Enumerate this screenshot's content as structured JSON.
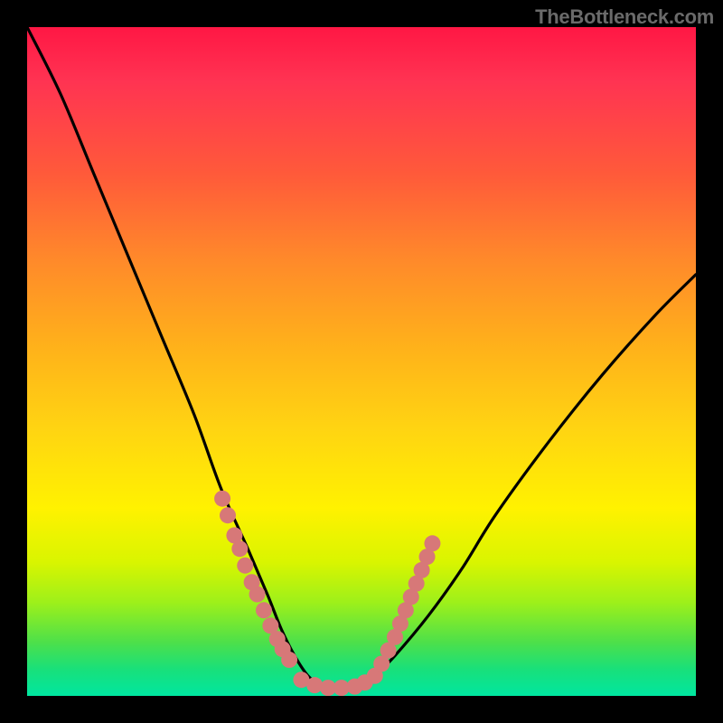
{
  "credit": "TheBottleneck.com",
  "chart_data": {
    "type": "line",
    "title": "",
    "xlabel": "",
    "ylabel": "",
    "xlim": [
      0,
      100
    ],
    "ylim": [
      0,
      100
    ],
    "grid": false,
    "legend": false,
    "series": [
      {
        "name": "bottleneck-curve",
        "x": [
          0,
          5,
          10,
          15,
          20,
          25,
          29,
          33,
          36,
          38,
          40,
          42,
          44,
          46,
          48,
          50,
          52,
          55,
          60,
          65,
          70,
          78,
          86,
          94,
          100
        ],
        "y": [
          100,
          90,
          78,
          66,
          54,
          42,
          31,
          22,
          15,
          10,
          6,
          3,
          1.5,
          1,
          1,
          1.5,
          3,
          6,
          12,
          19,
          27,
          38,
          48,
          57,
          63
        ]
      }
    ],
    "markers": [
      {
        "name": "left-descent-cluster",
        "color": "#d77878",
        "points": [
          {
            "x": 29.2,
            "y": 29.5
          },
          {
            "x": 30.0,
            "y": 27.0
          },
          {
            "x": 31.0,
            "y": 24.0
          },
          {
            "x": 31.8,
            "y": 22.0
          },
          {
            "x": 32.6,
            "y": 19.5
          },
          {
            "x": 33.6,
            "y": 17.0
          },
          {
            "x": 34.4,
            "y": 15.2
          },
          {
            "x": 35.4,
            "y": 12.8
          },
          {
            "x": 36.4,
            "y": 10.5
          },
          {
            "x": 37.4,
            "y": 8.5
          },
          {
            "x": 38.2,
            "y": 7.0
          },
          {
            "x": 39.2,
            "y": 5.4
          }
        ]
      },
      {
        "name": "bottom-cluster",
        "color": "#d77878",
        "points": [
          {
            "x": 41.0,
            "y": 2.4
          },
          {
            "x": 43.0,
            "y": 1.6
          },
          {
            "x": 45.0,
            "y": 1.2
          },
          {
            "x": 47.0,
            "y": 1.2
          },
          {
            "x": 49.0,
            "y": 1.4
          },
          {
            "x": 50.5,
            "y": 2.0
          },
          {
            "x": 52.0,
            "y": 3.0
          }
        ]
      },
      {
        "name": "right-ascent-cluster",
        "color": "#d77878",
        "points": [
          {
            "x": 53.0,
            "y": 4.8
          },
          {
            "x": 54.0,
            "y": 6.8
          },
          {
            "x": 55.0,
            "y": 8.8
          },
          {
            "x": 55.8,
            "y": 10.8
          },
          {
            "x": 56.6,
            "y": 12.8
          },
          {
            "x": 57.4,
            "y": 14.8
          },
          {
            "x": 58.2,
            "y": 16.8
          },
          {
            "x": 59.0,
            "y": 18.8
          },
          {
            "x": 59.8,
            "y": 20.8
          },
          {
            "x": 60.6,
            "y": 22.8
          }
        ]
      }
    ],
    "marker_radius": 9
  }
}
